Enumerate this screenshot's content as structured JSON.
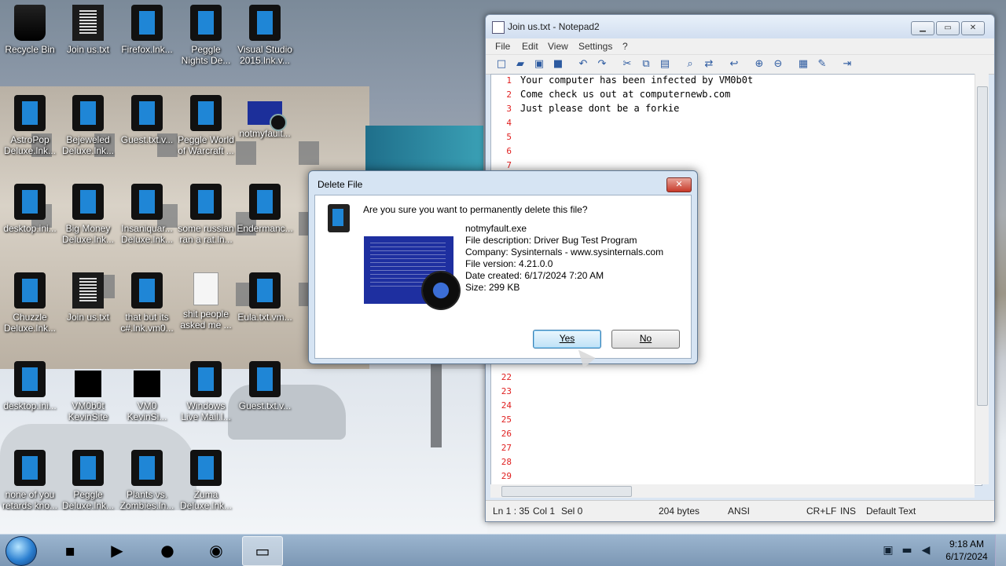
{
  "desktop": {
    "icons": [
      {
        "label": "Recycle Bin",
        "kind": "bin"
      },
      {
        "label": "Join us.txt",
        "kind": "txt"
      },
      {
        "label": "Firefox.lnk...",
        "kind": "app"
      },
      {
        "label": "Peggle\nNights De...",
        "kind": "app"
      },
      {
        "label": "Visual Studio\n2015.lnk.v...",
        "kind": "app"
      },
      {
        "label": "AstroPop\nDeluxe.lnk...",
        "kind": "app"
      },
      {
        "label": "Bejeweled\nDeluxe.lnk...",
        "kind": "app"
      },
      {
        "label": "Guest.txt.v...",
        "kind": "app"
      },
      {
        "label": "Peggle World\nof Warcraft ...",
        "kind": "app"
      },
      {
        "label": "notmyfault...",
        "kind": "scr"
      },
      {
        "label": "desktop.ini...",
        "kind": "app"
      },
      {
        "label": "Big Money\nDeluxe.lnk...",
        "kind": "app"
      },
      {
        "label": "Insaniquar...\nDeluxe.lnk...",
        "kind": "app"
      },
      {
        "label": "some russian\nran a rat.ln...",
        "kind": "app"
      },
      {
        "label": "Endermanc...",
        "kind": "app"
      },
      {
        "label": "Chuzzle\nDeluxe.lnk...",
        "kind": "app"
      },
      {
        "label": "Join us.txt",
        "kind": "txt"
      },
      {
        "label": "that but its\nc#.lnk.vm0...",
        "kind": "app"
      },
      {
        "label": "shit people\nasked me ...",
        "kind": "page"
      },
      {
        "label": "Eula.txt.vm...",
        "kind": "app"
      },
      {
        "label": "desktop.ini...",
        "kind": "app"
      },
      {
        "label": "VM0b0t\nKevinSite",
        "kind": "blk"
      },
      {
        "label": "VM0\nKevinSi...",
        "kind": "blk"
      },
      {
        "label": "Windows\nLive Mail.l...",
        "kind": "app"
      },
      {
        "label": "Guest.txt.v...",
        "kind": "app"
      },
      {
        "label": "none of you\nretards kno...",
        "kind": "app"
      },
      {
        "label": "Peggle\nDeluxe.lnk...",
        "kind": "app"
      },
      {
        "label": "Plants vs.\nZombies.ln...",
        "kind": "app"
      },
      {
        "label": "Zuma\nDeluxe.lnk...",
        "kind": "app"
      }
    ]
  },
  "notepad": {
    "title": "Join us.txt - Notepad2",
    "menu": [
      "File",
      "Edit",
      "View",
      "Settings",
      "?"
    ],
    "lines": [
      "Your computer has been infected by VM0b0t",
      "Come check us out at computernewb.com",
      "Just please dont be a forkie"
    ],
    "line_numbers": [
      "1",
      "2",
      "3",
      "4",
      "5",
      "6",
      "7",
      "22",
      "23",
      "24",
      "25",
      "26",
      "27",
      "28",
      "29"
    ],
    "status": {
      "position": "Ln 1 : 35",
      "col": "Col 1",
      "sel": "Sel 0",
      "size": "204 bytes",
      "encoding": "ANSI",
      "eol": "CR+LF",
      "mode": "INS",
      "scheme": "Default Text"
    }
  },
  "dialog": {
    "title": "Delete File",
    "close_glyph": "✕",
    "question": "Are you sure you want to permanently delete this file?",
    "file_name": "notmyfault.exe",
    "description": "File description: Driver Bug Test Program",
    "company": "Company: Sysinternals - www.sysinternals.com",
    "version": "File version: 4.21.0.0",
    "created": "Date created: 6/17/2024 7:20 AM",
    "size": "Size: 299 KB",
    "yes_label": "Yes",
    "no_label": "No"
  },
  "taskbar": {
    "time": "9:18 AM",
    "date": "6/17/2024"
  },
  "colors": {
    "line_number": "#e02020",
    "dialog_frame": "#d6e4f3",
    "taskbar": "#7c97b4"
  }
}
